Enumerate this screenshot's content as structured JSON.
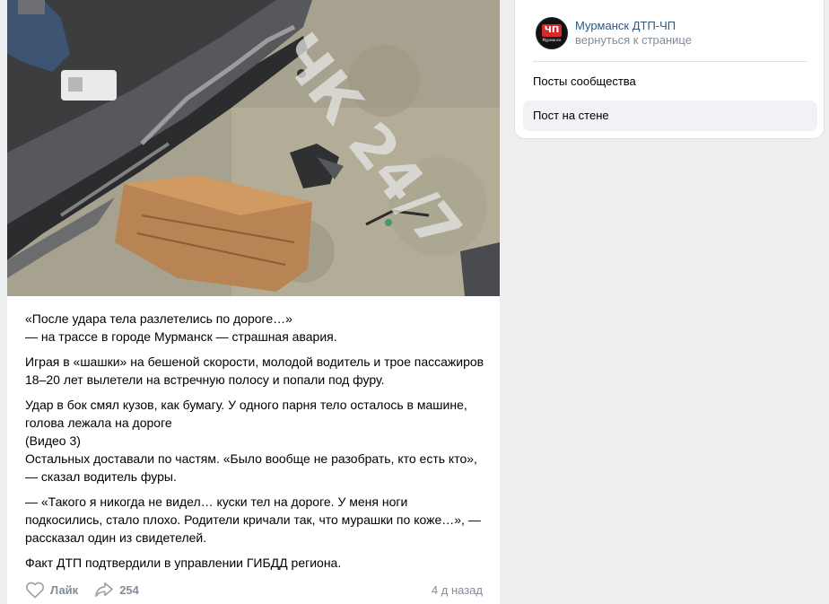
{
  "post": {
    "photo_watermark": "ЧК 24/7",
    "paragraphs": [
      "«После удара тела разлетелись по дороге…»",
      "— на трассе в городе Мурманск — страшная авария.",
      "Играя в «шашки» на бешеной скорости, молодой водитель и трое пассажиров 18–20 лет вылетели на встречную полосу и попали под фуру.",
      "Удар в бок смял кузов, как бумагу. У одного парня тело осталось в машине, голова лежала на дороге",
      "(Видео 3)",
      "Остальных доставали по частям. «Было вообще не разобрать, кто есть кто», — сказал водитель фуры.",
      "— «Такого я никогда не видел… куски тел на дороге. У меня ноги подкосились, стало плохо. Родители кричали так, что мурашки по коже…», — рассказал один из свидетелей.",
      "Факт ДТП подтвердили в управлении ГИБДД региона."
    ],
    "footer": {
      "like_label": "Лайк",
      "share_count": "254",
      "time": "4 д назад"
    },
    "icons": {
      "like": "heart-icon",
      "share": "share-arrow-icon"
    }
  },
  "sidebar": {
    "group": {
      "name": "Мурманск ДТП-ЧП",
      "back_link": "вернуться к странице",
      "avatar_text": "ЧП",
      "avatar_sub": "Мурманск"
    },
    "menu": [
      {
        "label": "Посты сообщества",
        "active": false
      },
      {
        "label": "Пост на стене",
        "active": true
      }
    ]
  },
  "colors": {
    "page_bg": "#edeef0",
    "link": "#2a5885",
    "secondary_text": "#818c99",
    "active_item_bg": "#f0f2f5",
    "avatar_red": "#d42a2a"
  }
}
